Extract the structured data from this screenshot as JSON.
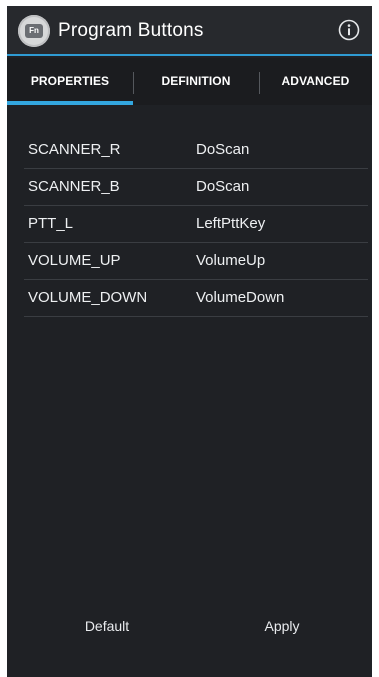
{
  "header": {
    "app_icon_badge": "Fn",
    "title": "Program Buttons",
    "info_icon": "info-icon"
  },
  "tabs": [
    {
      "label": "PROPERTIES",
      "selected": true
    },
    {
      "label": "DEFINITION",
      "selected": false
    },
    {
      "label": "ADVANCED",
      "selected": false
    }
  ],
  "mappings": [
    {
      "button": "SCANNER_R",
      "action": "DoScan"
    },
    {
      "button": "SCANNER_B",
      "action": "DoScan"
    },
    {
      "button": "PTT_L",
      "action": "LeftPttKey"
    },
    {
      "button": "VOLUME_UP",
      "action": "VolumeUp"
    },
    {
      "button": "VOLUME_DOWN",
      "action": "VolumeDown"
    }
  ],
  "footer": {
    "default_label": "Default",
    "apply_label": "Apply"
  },
  "colors": {
    "accent": "#33a7e0",
    "background": "#1f2125",
    "appbar": "#27292d",
    "divider": "#3a3d42"
  }
}
